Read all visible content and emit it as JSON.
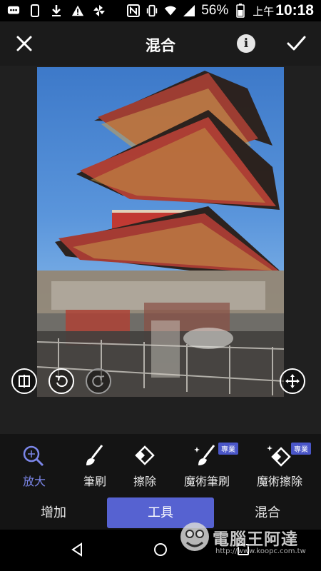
{
  "status_bar": {
    "battery_percent": "56%",
    "ampm": "上午",
    "time": "10:18",
    "icons": [
      "message-icon",
      "phone-icon",
      "download-icon",
      "warning-icon",
      "pinwheel-icon",
      "nfc-icon",
      "vibrate-icon",
      "wifi-icon",
      "signal-icon",
      "battery-icon"
    ]
  },
  "app_bar": {
    "title": "混合",
    "close_icon": "close-icon",
    "info_icon": "info-icon",
    "info_glyph": "i",
    "confirm_icon": "check-icon"
  },
  "canvas": {
    "controls": [
      "compare-icon",
      "undo-icon",
      "redo-icon",
      "move-icon"
    ]
  },
  "tools": [
    {
      "label": "放大",
      "icon": "zoom-icon",
      "active": true
    },
    {
      "label": "筆刷",
      "icon": "brush-icon",
      "active": false
    },
    {
      "label": "擦除",
      "icon": "eraser-icon",
      "active": false
    },
    {
      "label": "魔術筆刷",
      "icon": "magic-brush-icon",
      "active": false,
      "badge": "專業"
    },
    {
      "label": "魔術擦除",
      "icon": "magic-eraser-icon",
      "active": false,
      "badge": "專業"
    }
  ],
  "tabs": [
    {
      "label": "增加",
      "active": false
    },
    {
      "label": "工具",
      "active": true
    },
    {
      "label": "混合",
      "active": false
    }
  ],
  "watermark": {
    "text": "電腦王阿達",
    "url": "http://www.koopc.com.tw"
  },
  "colors": {
    "accent": "#5662d1",
    "active_label": "#7b86e8",
    "badge": "#4a56c8"
  }
}
